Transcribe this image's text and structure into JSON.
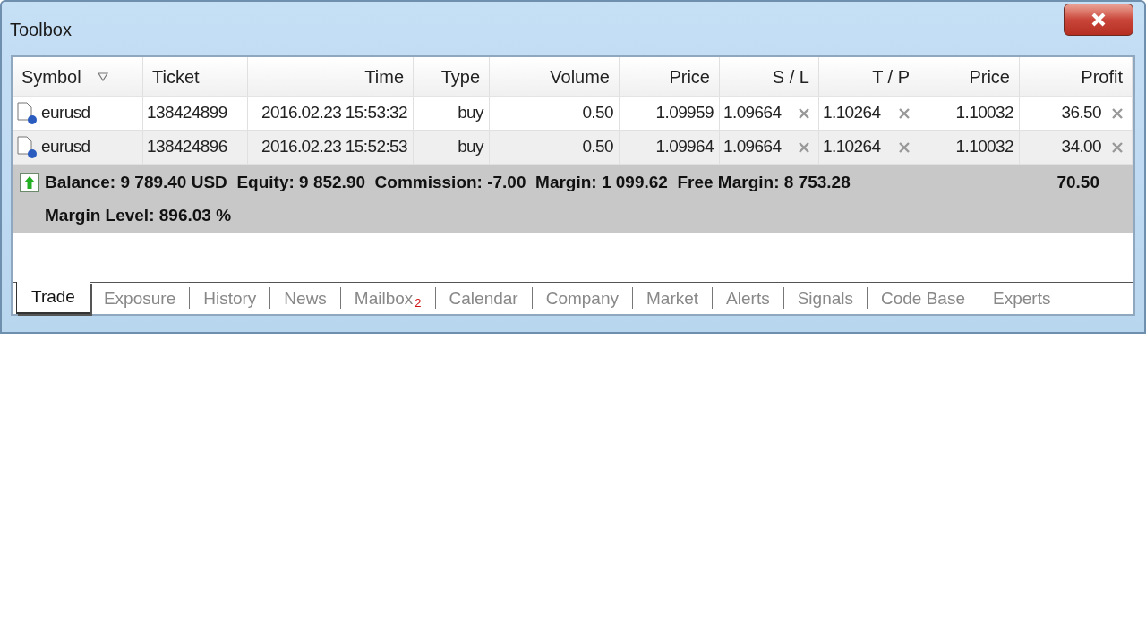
{
  "window": {
    "title": "Toolbox"
  },
  "table": {
    "columns": [
      {
        "label": "Symbol",
        "sorted": true
      },
      {
        "label": "Ticket",
        "sorted": false
      },
      {
        "label": "Time",
        "sorted": false
      },
      {
        "label": "Type",
        "sorted": false
      },
      {
        "label": "Volume",
        "sorted": false
      },
      {
        "label": "Price",
        "sorted": false
      },
      {
        "label": "S / L",
        "sorted": false
      },
      {
        "label": "T / P",
        "sorted": false
      },
      {
        "label": "Price",
        "sorted": false
      },
      {
        "label": "Profit",
        "sorted": false
      }
    ],
    "rows": [
      {
        "symbol": "eurusd",
        "ticket": "138424899",
        "time": "2016.02.23 15:53:32",
        "type": "buy",
        "volume": "0.50",
        "price": "1.09959",
        "sl": "1.09664",
        "tp": "1.10264",
        "current_price": "1.10032",
        "profit": "36.50"
      },
      {
        "symbol": "eurusd",
        "ticket": "138424896",
        "time": "2016.02.23 15:52:53",
        "type": "buy",
        "volume": "0.50",
        "price": "1.09964",
        "sl": "1.09664",
        "tp": "1.10264",
        "current_price": "1.10032",
        "profit": "34.00"
      }
    ],
    "summary": {
      "line_1": "Balance: 9 789.40 USD  Equity: 9 852.90  Commission: -7.00  Margin: 1 099.62  Free Margin: 8 753.28",
      "total_profit": "70.50",
      "line_2": "Margin Level: 896.03 %"
    }
  },
  "tabs": [
    {
      "label": "Trade",
      "selected": true
    },
    {
      "label": "Exposure",
      "selected": false
    },
    {
      "label": "History",
      "selected": false
    },
    {
      "label": "News",
      "selected": false
    },
    {
      "label": "Mailbox",
      "badge": "2",
      "selected": false
    },
    {
      "label": "Calendar",
      "selected": false
    },
    {
      "label": "Company",
      "selected": false
    },
    {
      "label": "Market",
      "selected": false
    },
    {
      "label": "Alerts",
      "selected": false
    },
    {
      "label": "Signals",
      "selected": false
    },
    {
      "label": "Code Base",
      "selected": false
    },
    {
      "label": "Experts",
      "selected": false
    }
  ]
}
